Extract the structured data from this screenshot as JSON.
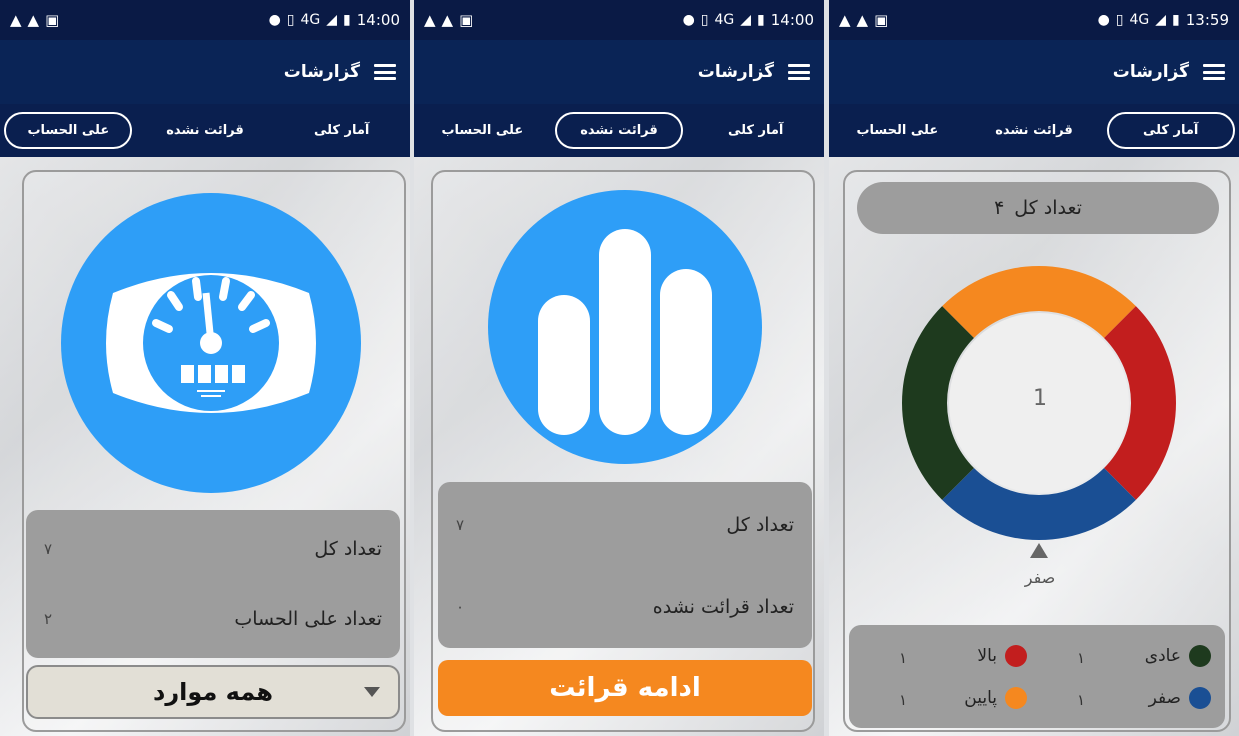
{
  "status_bars": [
    {
      "time": "14:00",
      "network": "4G"
    },
    {
      "time": "14:00",
      "network": "4G"
    },
    {
      "time": "13:59",
      "network": "4G"
    }
  ],
  "appbar": {
    "title": "گزارشات"
  },
  "tabs": {
    "overall": "آمار کلی",
    "unread": "قرائت نشده",
    "on_account": "علی الحساب"
  },
  "screen1": {
    "rows": [
      {
        "label": "تعداد کل",
        "value": "۷"
      },
      {
        "label": "تعداد علی الحساب",
        "value": "۲"
      }
    ],
    "dropdown_selected": "همه موارد",
    "icon": "water-meter-icon"
  },
  "screen2": {
    "rows": [
      {
        "label": "تعداد کل",
        "value": "۷"
      },
      {
        "label": "تعداد قرائت نشده",
        "value": "۰"
      }
    ],
    "button_label": "ادامه قرائت",
    "icon": "bar-chart-icon"
  },
  "screen3": {
    "total_label": "تعداد کل",
    "total_value": "۴",
    "center_value": "1",
    "pointer_label": "صفر",
    "chart_data": {
      "type": "pie",
      "categories": [
        "عادی",
        "بالا",
        "صفر",
        "پایین"
      ],
      "values": [
        1,
        1,
        1,
        1
      ],
      "colors": [
        "#1e3a1e",
        "#c21e1e",
        "#1a4f94",
        "#f5881f"
      ]
    },
    "legend": [
      {
        "label": "عادی",
        "value": "۱",
        "color": "#1e3a1e"
      },
      {
        "label": "بالا",
        "value": "۱",
        "color": "#c21e1e"
      },
      {
        "label": "صفر",
        "value": "۱",
        "color": "#1a4f94"
      },
      {
        "label": "پایین",
        "value": "۱",
        "color": "#f5881f"
      }
    ]
  },
  "colors": {
    "statusbar": "#0a1a45",
    "appbar": "#0a2456",
    "accent_blue": "#2e9ef7",
    "orange": "#f5881f"
  }
}
